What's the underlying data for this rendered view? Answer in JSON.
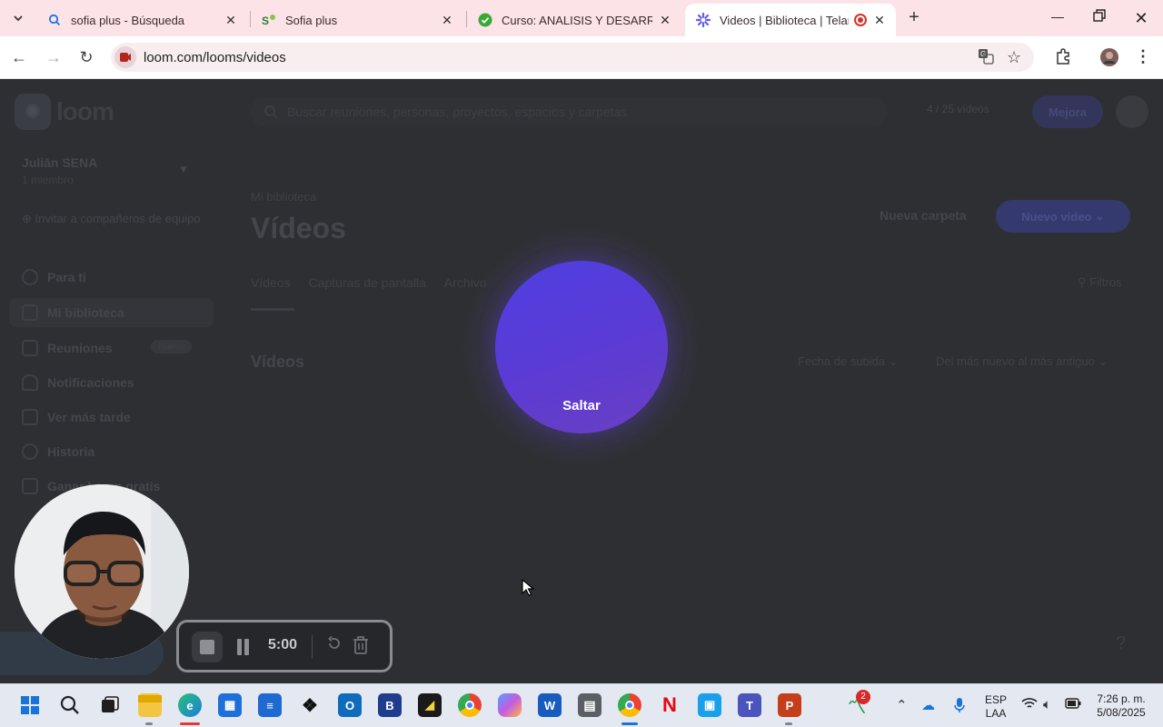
{
  "browser": {
    "tabs": [
      {
        "title": "sofia plus - Búsqueda",
        "active": false
      },
      {
        "title": "Sofia plus",
        "active": false
      },
      {
        "title": "Curso: ANALISIS Y DESARROLLO",
        "active": false
      },
      {
        "title": "Videos | Biblioteca | Telar",
        "active": true
      }
    ],
    "url": "loom.com/looms/videos"
  },
  "loom": {
    "logo_text": "loom",
    "workspace_name": "Julián SENA",
    "workspace_sub": "1 miembro",
    "invite_label": "Invitar a compañeros de equipo",
    "nav": [
      {
        "label": "Para ti"
      },
      {
        "label": "Mi biblioteca"
      },
      {
        "label": "Reuniones"
      },
      {
        "label": "Notificaciones"
      },
      {
        "label": "Ver más tarde"
      },
      {
        "label": "Historia"
      },
      {
        "label": "Ganar Loom gratis"
      }
    ],
    "nav_new_badge": "Nuevo",
    "search_placeholder": "Buscar reuniones, personas, proyectos, espacios y carpetas",
    "video_count": "4 / 25 vídeos",
    "upgrade_label": "Mejora",
    "breadcrumb": "Mi biblioteca",
    "page_title": "Vídeos",
    "new_folder_label": "Nueva carpeta",
    "new_video_label": "Nuevo video",
    "content_tabs": [
      "Vídeos",
      "Capturas de pantalla",
      "Archivo"
    ],
    "filter_label": "Filtros",
    "section_title": "Vídeos",
    "sort_field": "Fecha de subida",
    "sort_order": "Del más nuevo al más antiguo"
  },
  "countdown": {
    "skip_label": "Saltar",
    "color_start": "#4f3fe0",
    "color_end": "#6a3fc2"
  },
  "recorder": {
    "timer": "5:00"
  },
  "taskbar": {
    "language_line1": "ESP",
    "language_line2": "LAA",
    "time": "7:26 p. m.",
    "date": "5/08/2025",
    "notification_badge": "2"
  }
}
